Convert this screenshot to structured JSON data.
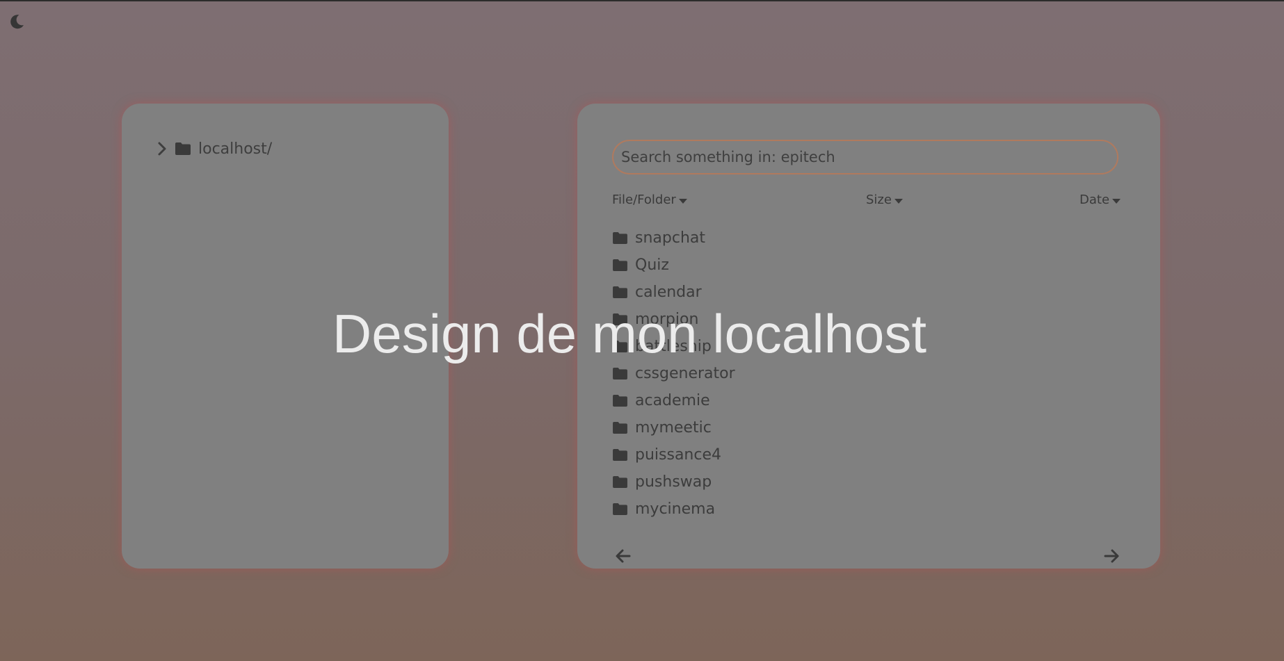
{
  "theme_toggle": {
    "icon": "moon-icon"
  },
  "tree": {
    "root_label": "localhost/",
    "expand_icon": "chevron-right-icon",
    "folder_icon": "folder-icon"
  },
  "search": {
    "placeholder": "Search something in: epitech",
    "value": ""
  },
  "columns": {
    "file_folder": "File/Folder",
    "size": "Size",
    "date": "Date"
  },
  "files": [
    "snapchat",
    "Quiz",
    "calendar",
    "morpion",
    "battleship",
    "cssgenerator",
    "academie",
    "mymeetic",
    "puissance4",
    "pushswap",
    "mycinema"
  ],
  "pagination": {
    "prev_icon": "arrow-left-icon",
    "next_icon": "arrow-right-icon"
  },
  "overlay": {
    "title": "Design de mon localhost"
  },
  "colors": {
    "panel": "#808080",
    "text": "#3c3c3c",
    "search_border": "#b07a5e",
    "overlay_text": "#ececec"
  }
}
